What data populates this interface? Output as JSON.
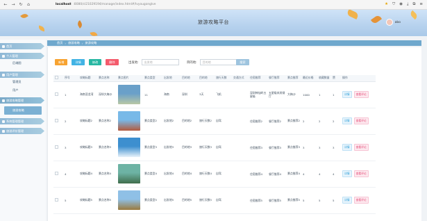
{
  "browser": {
    "url_host": "localhost",
    "url_path": ":8080/cl21029194/manage/index.html#/lvyougonglve",
    "nav_back": "←",
    "nav_forward": "→",
    "nav_reload": "↻",
    "nav_home": "⌂"
  },
  "header": {
    "title": "旅游攻略平台",
    "username": "abo"
  },
  "sidebar": {
    "groups": [
      {
        "label": "首页"
      },
      {
        "label": "个人管理",
        "items": [
          {
            "label": "后端图"
          }
        ]
      },
      {
        "label": "用户管理",
        "items": [
          {
            "label": "管理员"
          },
          {
            "label": "用户"
          }
        ]
      },
      {
        "label": "旅游攻略管理",
        "items": [
          {
            "label": "旅游攻略"
          }
        ]
      },
      {
        "label": "系统管理管理"
      },
      {
        "label": "旅游评价管理"
      }
    ]
  },
  "breadcrumb": {
    "items": [
      "首页",
      "旅游攻略",
      "旅游攻略"
    ]
  },
  "toolbar": {
    "add": "新增",
    "detail": "详情",
    "edit": "修改",
    "delete": "删除",
    "from_label": "出发地:",
    "from_placeholder": "出发地",
    "to_label": "目的地:",
    "to_placeholder": "目的地",
    "search": "搜索"
  },
  "table": {
    "columns": [
      "",
      "序号",
      "攻略标题",
      "景点名称",
      "景点图片",
      "景点类型",
      "出发地",
      "目的地",
      "目的地",
      "旅行天数",
      "交通方式",
      "住宿推荐",
      "餐厅推荐",
      "景点推荐",
      "最近价格",
      "收藏数量",
      "赞",
      "操作"
    ],
    "rows": [
      {
        "idx": "1",
        "title": "海南亚龙湾",
        "spot": "深圳大梅沙",
        "thumb_color_top": "#6aa0c9",
        "thumb_color_bottom": "#b9c8a5",
        "type": "11",
        "from": "海南",
        "to": "深圳",
        "to2": "3天",
        "days": "飞机",
        "traffic": "",
        "hotel": "深圳神仙岭五星级",
        "food": "五星级米其餐厅",
        "scenic": "大梅沙",
        "price": "1000",
        "fav": "1",
        "like": "1"
      },
      {
        "idx": "2",
        "title": "攻略标题2",
        "spot": "景点名称2",
        "thumb_color_top": "#78b9e8",
        "thumb_color_bottom": "#b45a3d",
        "type": "景点类型2",
        "from": "出发地2",
        "to": "目的地2",
        "to2": "旅行天数2",
        "days": "自驾",
        "traffic": "",
        "hotel": "住宿推荐2",
        "food": "餐厅推荐2",
        "scenic": "景点推荐2",
        "price": "2",
        "fav": "2",
        "like": "2"
      },
      {
        "idx": "3",
        "title": "攻略标题3",
        "spot": "景点名称3",
        "thumb_color_top": "#3d8fcf",
        "thumb_color_bottom": "#e8f2fa",
        "type": "景点类型3",
        "from": "出发地3",
        "to": "目的地3",
        "to2": "旅行天数3",
        "days": "自驾",
        "traffic": "",
        "hotel": "住宿推荐3",
        "food": "餐厅推荐3",
        "scenic": "景点推荐3",
        "price": "3",
        "fav": "3",
        "like": "3"
      },
      {
        "idx": "4",
        "title": "攻略标题4",
        "spot": "景点名称4",
        "thumb_color_top": "#6db3a4",
        "thumb_color_bottom": "#3f6d4c",
        "type": "景点类型4",
        "from": "出发地4",
        "to": "目的地4",
        "to2": "旅行天数4",
        "days": "自驾",
        "traffic": "",
        "hotel": "住宿推荐4",
        "food": "餐厅推荐4",
        "scenic": "景点推荐4",
        "price": "4",
        "fav": "4",
        "like": "4"
      },
      {
        "idx": "5",
        "title": "攻略标题5",
        "spot": "景点名称5",
        "thumb_color_top": "#8fc0e6",
        "thumb_color_bottom": "#9a7a3c",
        "type": "景点类型5",
        "from": "出发地5",
        "to": "目的地5",
        "to2": "旅行天数5",
        "days": "自驾",
        "traffic": "",
        "hotel": "住宿推荐5",
        "food": "餐厅推荐5",
        "scenic": "景点推荐5",
        "price": "5",
        "fav": "5",
        "like": "5"
      }
    ],
    "action_detail": "详情",
    "action_review": "查看评论"
  },
  "colors": {
    "accent": "#6fa8cd",
    "header_bg": "#b7d2ee"
  }
}
